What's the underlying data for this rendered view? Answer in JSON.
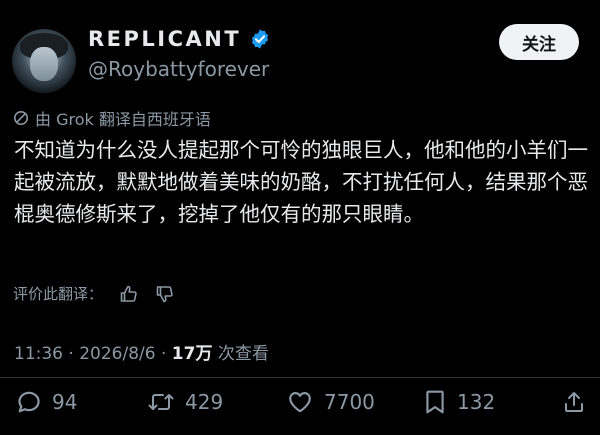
{
  "author": {
    "display_name": "REPLICANT",
    "handle": "@Roybattyforever",
    "verified": true
  },
  "follow_button": {
    "label": "关注"
  },
  "translation_note": "由 Grok 翻译自西班牙语",
  "tweet": {
    "text": "不知道为什么没人提起那个可怜的独眼巨人，他和他的小羊们一起被流放，默默地做着美味的奶酪，不打扰任何人，结果那个恶棍奥德修斯来了，挖掉了他仅有的那只眼睛。"
  },
  "rate_translation": {
    "label": "评价此翻译："
  },
  "meta": {
    "time": "11:36",
    "separator": " · ",
    "date": "2026/8/6",
    "views_count": "17万",
    "views_label": " 次查看"
  },
  "actions": {
    "replies": "94",
    "retweets": "429",
    "likes": "7700",
    "bookmarks": "132"
  },
  "icons": {
    "verified": "verified-badge-icon",
    "translate": "translate-icon",
    "thumbs_up": "thumbs-up-icon",
    "thumbs_down": "thumbs-down-icon",
    "reply": "reply-icon",
    "retweet": "retweet-icon",
    "like": "heart-icon",
    "bookmark": "bookmark-icon",
    "share": "share-icon"
  },
  "colors": {
    "background": "#000000",
    "text": "#e7e9ea",
    "secondary_text": "#8b98a5",
    "verified_blue": "#1d9bf0",
    "follow_button_bg": "#eff3f4"
  }
}
